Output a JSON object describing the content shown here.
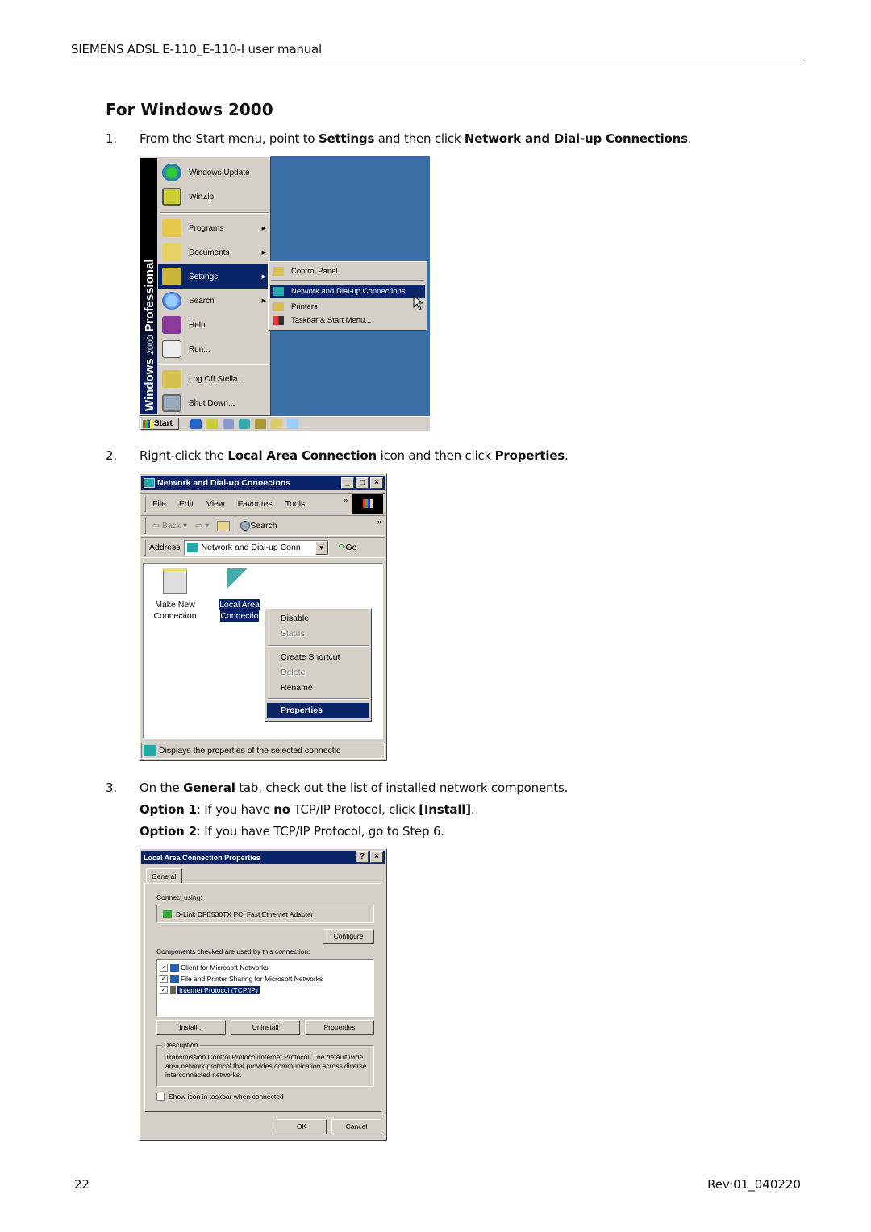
{
  "document": {
    "header": "SIEMENS ADSL E-110_E-110-I user manual",
    "section_title": "For Windows 2000",
    "page_number": "22",
    "revision": "Rev:01_040220"
  },
  "steps": [
    {
      "number": "1.",
      "parts": [
        "From the Start menu, point to ",
        "Settings",
        " and then click ",
        "Network and Dial-up Connections",
        "."
      ]
    },
    {
      "number": "2.",
      "parts": [
        "Right-click the ",
        "Local Area Connection",
        " icon and then click ",
        "Properties",
        "."
      ]
    },
    {
      "number": "3.",
      "parts": [
        "On the ",
        "General",
        " tab, check out the list of installed network components."
      ],
      "options": [
        {
          "parts": [
            "Option 1",
            ": If you have ",
            "no",
            " TCP/IP Protocol, click ",
            "[Install]",
            "."
          ]
        },
        {
          "parts": [
            "Option 2",
            ": If you have TCP/IP Protocol, go to Step 6."
          ]
        }
      ]
    }
  ],
  "screenshot_start_menu": {
    "banner_bold": "Windows",
    "banner_light": "2000",
    "banner_bold2": "Professional",
    "items": [
      {
        "label": "Windows Update",
        "icon": "globe-icon"
      },
      {
        "label": "WinZip",
        "icon": "winzip-icon"
      },
      {
        "label": "Programs",
        "icon": "programs-icon",
        "submenu": true
      },
      {
        "label": "Documents",
        "icon": "documents-icon",
        "submenu": true
      },
      {
        "label": "Settings",
        "icon": "settings-icon",
        "submenu": true,
        "selected": true
      },
      {
        "label": "Search",
        "icon": "search-icon",
        "submenu": true
      },
      {
        "label": "Help",
        "icon": "help-icon"
      },
      {
        "label": "Run...",
        "icon": "run-icon"
      },
      {
        "label": "Log Off Stella...",
        "icon": "logoff-icon"
      },
      {
        "label": "Shut Down...",
        "icon": "shutdown-icon"
      }
    ],
    "settings_submenu": [
      {
        "label": "Control Panel",
        "icon": "control-panel-icon"
      },
      {
        "label": "Network and Dial-up Connections",
        "icon": "network-icon",
        "selected": true
      },
      {
        "label": "Printers",
        "icon": "printers-icon"
      },
      {
        "label": "Taskbar & Start Menu...",
        "icon": "taskbar-icon"
      }
    ],
    "start_button": "Start"
  },
  "screenshot_network_window": {
    "title": "Network and Dial-up Connectons",
    "menu": [
      "File",
      "Edit",
      "View",
      "Favorites",
      "Tools"
    ],
    "toolbar": {
      "back": "Back",
      "search": "Search"
    },
    "address_label": "Address",
    "address_value": "Network and Dial-up Conn",
    "go_label": "Go",
    "icons": [
      {
        "line1": "Make New",
        "line2": "Connection"
      },
      {
        "line1": "Local Area",
        "line2": "Connectio",
        "selected": true
      }
    ],
    "context_menu": [
      {
        "label": "Disable",
        "enabled": true
      },
      {
        "label": "Status",
        "enabled": false
      },
      {
        "label": "Create Shortcut",
        "enabled": true
      },
      {
        "label": "Delete",
        "enabled": false
      },
      {
        "label": "Rename",
        "enabled": true
      },
      {
        "label": "Properties",
        "enabled": true,
        "selected": true
      }
    ],
    "status_text": "Displays the properties of the selected connectic"
  },
  "screenshot_properties_dialog": {
    "title": "Local Area Connection Properties",
    "tab": "General",
    "connect_using_label": "Connect using:",
    "adapter": "D-Link DFE530TX PCI Fast Ethernet Adapter",
    "configure_button": "Configure",
    "components_label": "Components checked are used by this connection:",
    "components": [
      {
        "label": "Client for Microsoft Networks",
        "checked": true
      },
      {
        "label": "File and Printer Sharing for Microsoft Networks",
        "checked": true
      },
      {
        "label": "Internet Protocol (TCP/IP)",
        "checked": true,
        "selected": true
      }
    ],
    "install_button": "Install...",
    "uninstall_button": "Uninstall",
    "properties_button": "Properties",
    "description_legend": "Description",
    "description_text": "Transmission Control Protocol/Internet Protocol. The default wide area network protocol that provides communication across diverse interconnected networks.",
    "show_icon_label": "Show icon in taskbar when connected",
    "show_icon_checked": false,
    "ok_button": "OK",
    "cancel_button": "Cancel"
  },
  "colors": {
    "desktop": "#3a6ea5",
    "selection": "#0a246a",
    "window_face": "#d4d0c8"
  }
}
